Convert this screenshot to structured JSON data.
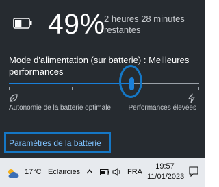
{
  "battery": {
    "percent_text": "49%",
    "percent_value": 49,
    "remaining_text": "2 heures 28 minutes restantes"
  },
  "power_mode": {
    "label": "Mode d'alimentation (sur batterie) : Meilleures performances",
    "slider_value": 0.645,
    "left_label": "Autonomie de la batterie optimale",
    "right_label": "Performances élevées"
  },
  "settings": {
    "link_label": "Paramètres de la batterie"
  },
  "taskbar": {
    "temperature": "17°C",
    "condition": "Eclaircies",
    "language": "FRA",
    "time": "19:57",
    "date": "11/01/2023"
  },
  "colors": {
    "flyout_bg": "#262b30",
    "accent": "#1a7fd8",
    "highlight": "#1577c5",
    "link": "#7ec2ff",
    "taskbar_bg": "#e7eaee"
  },
  "icons": [
    "battery-icon",
    "leaf-icon",
    "bolt-icon",
    "weather-icon",
    "chevron-up-icon",
    "battery-small-icon",
    "volume-icon",
    "notification-icon"
  ]
}
